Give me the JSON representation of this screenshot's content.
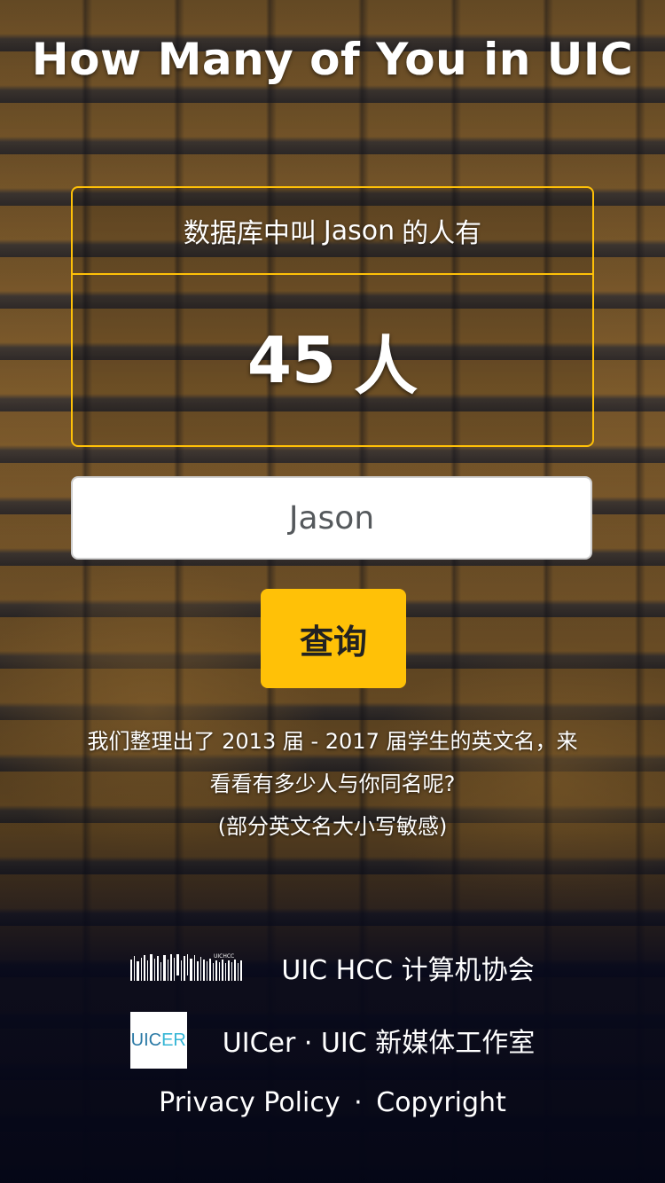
{
  "header": {
    "title": "How Many of You in UIC"
  },
  "result": {
    "label_prefix": "数据库中叫",
    "name": "Jason",
    "label_suffix": "的人有",
    "count": "45",
    "unit": "人"
  },
  "search": {
    "value": "Jason",
    "button_label": "查询"
  },
  "description": {
    "line1": "我们整理出了 2013 届 - 2017 届学生的英文名，来",
    "line2": "看看有多少人与你同名呢?",
    "line3": "(部分英文名大小写敏感)"
  },
  "footer": {
    "hcc_logo_text": "UICHCC",
    "hcc_label": "UIC HCC 计算机协会",
    "uicer_logo_text_a": "UIC",
    "uicer_logo_text_b": "ER",
    "uicer_label": "UICer · UIC 新媒体工作室",
    "privacy_label": "Privacy Policy",
    "separator": "·",
    "copyright_label": "Copyright"
  },
  "colors": {
    "accent": "#ffc107",
    "text": "#ffffff",
    "button_text": "#222222",
    "input_text": "#55595c"
  }
}
